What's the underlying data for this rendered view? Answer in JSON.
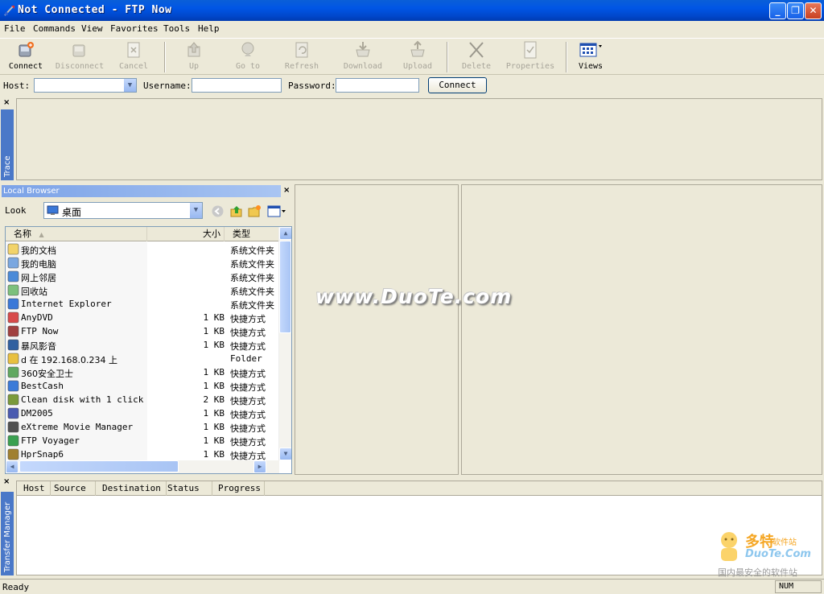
{
  "window": {
    "title": "Not Connected - FTP Now",
    "minimize": "_",
    "restore": "❐",
    "close": "✕"
  },
  "menu": [
    "File",
    "Commands",
    "View",
    "Favorites",
    "Tools",
    "Help"
  ],
  "toolbar": {
    "connect": "Connect",
    "disconnect": "Disconnect",
    "cancel": "Cancel",
    "up": "Up",
    "goto": "Go to",
    "refresh": "Refresh",
    "download": "Download",
    "upload": "Upload",
    "delete": "Delete",
    "properties": "Properties",
    "views": "Views"
  },
  "connect_bar": {
    "host_label": "Host:",
    "host_value": "",
    "username_label": "Username:",
    "username_value": "",
    "password_label": "Password:",
    "password_value": "",
    "connect_button": "Connect"
  },
  "trace": {
    "tab_label": "Trace",
    "close": "×"
  },
  "local_browser": {
    "title": "Local Browser",
    "close": "×",
    "look_label": "Look",
    "look_value": "桌面",
    "columns": {
      "name": "名称",
      "size": "大小",
      "type": "类型"
    },
    "files": [
      {
        "name": "我的文档",
        "size": "",
        "type": "系统文件夹",
        "icon": "my-documents-icon"
      },
      {
        "name": "我的电脑",
        "size": "",
        "type": "系统文件夹",
        "icon": "my-computer-icon"
      },
      {
        "name": "网上邻居",
        "size": "",
        "type": "系统文件夹",
        "icon": "network-icon"
      },
      {
        "name": "回收站",
        "size": "",
        "type": "系统文件夹",
        "icon": "recycle-bin-icon"
      },
      {
        "name": "Internet Explorer",
        "size": "",
        "type": "系统文件夹",
        "icon": "ie-icon"
      },
      {
        "name": "AnyDVD",
        "size": "1 KB",
        "type": "快捷方式",
        "icon": "anydvd-icon"
      },
      {
        "name": "FTP Now",
        "size": "1 KB",
        "type": "快捷方式",
        "icon": "ftp-now-icon"
      },
      {
        "name": "暴风影音",
        "size": "1 KB",
        "type": "快捷方式",
        "icon": "media-player-icon"
      },
      {
        "name": "d 在 192.168.0.234 上",
        "size": "",
        "type": "Folder",
        "icon": "network-drive-icon"
      },
      {
        "name": "360安全卫士",
        "size": "1 KB",
        "type": "快捷方式",
        "icon": "security-icon"
      },
      {
        "name": "BestCash",
        "size": "1 KB",
        "type": "快捷方式",
        "icon": "bestcash-icon"
      },
      {
        "name": "Clean disk with 1 click",
        "size": "2 KB",
        "type": "快捷方式",
        "icon": "clean-disk-icon"
      },
      {
        "name": "DM2005",
        "size": "1 KB",
        "type": "快捷方式",
        "icon": "dm2005-icon"
      },
      {
        "name": "eXtreme Movie Manager",
        "size": "1 KB",
        "type": "快捷方式",
        "icon": "movie-manager-icon"
      },
      {
        "name": "FTP Voyager",
        "size": "1 KB",
        "type": "快捷方式",
        "icon": "ftp-voyager-icon"
      },
      {
        "name": "HprSnap6",
        "size": "1 KB",
        "type": "快捷方式",
        "icon": "hprsnap-icon"
      }
    ]
  },
  "transfer_manager": {
    "tab_label": "Transfer Manager",
    "close": "×",
    "columns": [
      "Host",
      "Source",
      "Destination",
      "Status",
      "Progress"
    ]
  },
  "watermark": {
    "center": "www.DuoTe.com",
    "corner_big": "多特",
    "corner_small": "软件站",
    "corner_url": "DuoTe.Com",
    "corner_slogan": "国内最安全的软件站"
  },
  "status": {
    "text": "Ready",
    "num": "NUM"
  }
}
